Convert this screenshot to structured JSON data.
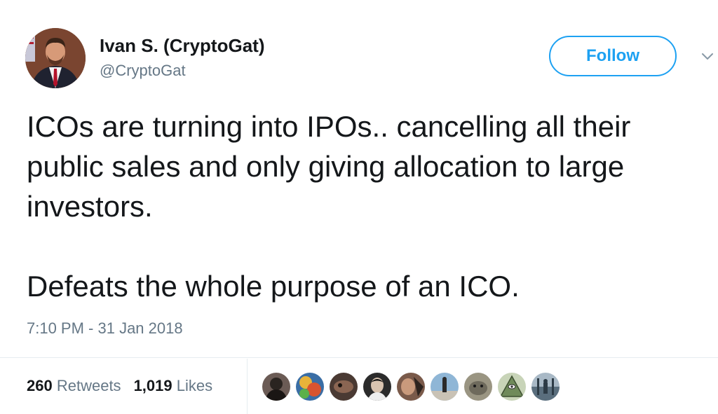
{
  "author": {
    "name": "Ivan S. (CryptoGat)",
    "handle": "@CryptoGat"
  },
  "follow_button": {
    "label": "Follow"
  },
  "tweet": {
    "paragraph1": "ICOs are turning into IPOs.. cancelling all their public sales and only giving allocation to large investors.",
    "paragraph2": "Defeats the whole purpose of an ICO."
  },
  "timestamp": "7:10 PM - 31 Jan 2018",
  "stats": {
    "retweets_count": "260",
    "retweets_label": "Retweets",
    "likes_count": "1,019",
    "likes_label": "Likes"
  },
  "colors": {
    "accent": "#1da1f2",
    "text": "#14171a",
    "secondary": "#657786",
    "divider": "#e6ecf0"
  },
  "icons": {
    "more_menu": "chevron-down-icon"
  }
}
